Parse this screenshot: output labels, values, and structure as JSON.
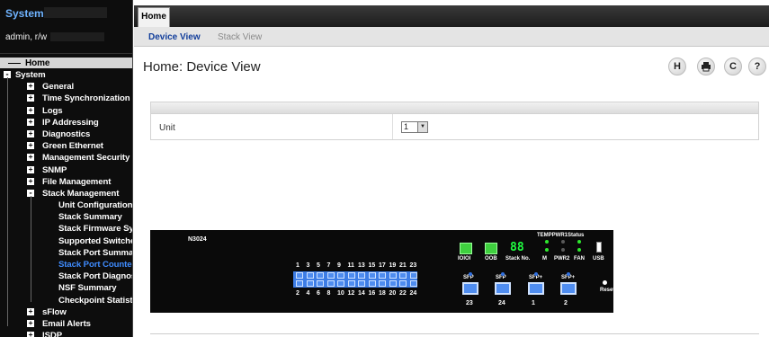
{
  "sidebar": {
    "title": "System",
    "user": "admin, r/w",
    "tree": [
      {
        "label": "Home",
        "level": "home"
      },
      {
        "label": "System",
        "level": "lvl1",
        "exp": "−"
      },
      {
        "label": "General",
        "level": "lvl2",
        "exp": "+"
      },
      {
        "label": "Time Synchronization",
        "level": "lvl2",
        "exp": "+"
      },
      {
        "label": "Logs",
        "level": "lvl2",
        "exp": "+"
      },
      {
        "label": "IP Addressing",
        "level": "lvl2",
        "exp": "+"
      },
      {
        "label": "Diagnostics",
        "level": "lvl2",
        "exp": "+"
      },
      {
        "label": "Green Ethernet",
        "level": "lvl2",
        "exp": "+"
      },
      {
        "label": "Management Security",
        "level": "lvl2",
        "exp": "+"
      },
      {
        "label": "SNMP",
        "level": "lvl2",
        "exp": "+"
      },
      {
        "label": "File Management",
        "level": "lvl2",
        "exp": "+"
      },
      {
        "label": "Stack Management",
        "level": "lvl2",
        "exp": "−"
      },
      {
        "label": "Unit Configuration",
        "level": "lvl3"
      },
      {
        "label": "Stack Summary",
        "level": "lvl3"
      },
      {
        "label": "Stack Firmware Syn",
        "level": "lvl3"
      },
      {
        "label": "Supported Switches",
        "level": "lvl3"
      },
      {
        "label": "Stack Port Summar",
        "level": "lvl3"
      },
      {
        "label": "Stack Port Counters",
        "level": "lvl3",
        "active": true
      },
      {
        "label": "Stack Port Diagnost",
        "level": "lvl3"
      },
      {
        "label": "NSF Summary",
        "level": "lvl3"
      },
      {
        "label": "Checkpoint Statistic",
        "level": "lvl3"
      },
      {
        "label": "sFlow",
        "level": "lvl2",
        "exp": "+"
      },
      {
        "label": "Email Alerts",
        "level": "lvl2",
        "exp": "+"
      },
      {
        "label": "ISDP",
        "level": "lvl2",
        "exp": "+"
      }
    ]
  },
  "topbar": {
    "home_tab": "Home"
  },
  "subtabs": {
    "device_view": "Device View",
    "stack_view": "Stack View"
  },
  "page": {
    "title": "Home: Device View"
  },
  "toolbar": {
    "save_icon": "H",
    "print_icon": "print-icon",
    "refresh_icon": "C",
    "help_icon": "?"
  },
  "unit": {
    "label": "Unit",
    "value": "1"
  },
  "device": {
    "model": "N3024",
    "status_header": "TEMPPWR1Status",
    "top_port_numbers": [
      "1",
      "3",
      "5",
      "7",
      "9",
      "11",
      "13",
      "15",
      "17",
      "19",
      "21",
      "23"
    ],
    "bottom_port_numbers": [
      "2",
      "4",
      "6",
      "8",
      "10",
      "12",
      "14",
      "16",
      "18",
      "20",
      "22",
      "24"
    ],
    "ioioi": "IOIOI",
    "oob": "OOB",
    "stack_no_label": "Stack No.",
    "stack_no_value": "88",
    "m_label": "M",
    "pwr2_label": "PWR2",
    "fan_label": "FAN",
    "usb_label": "USB",
    "sfp_labels": [
      "SFP",
      "SFP",
      "SFP+",
      "SFP+"
    ],
    "sfp_numbers": [
      "23",
      "24",
      "1",
      "2"
    ],
    "reset_label": "Reset"
  },
  "colors": {
    "accent": "#3f8cff",
    "led_green": "#3fd03f",
    "port_blue": "#4f8df0"
  }
}
